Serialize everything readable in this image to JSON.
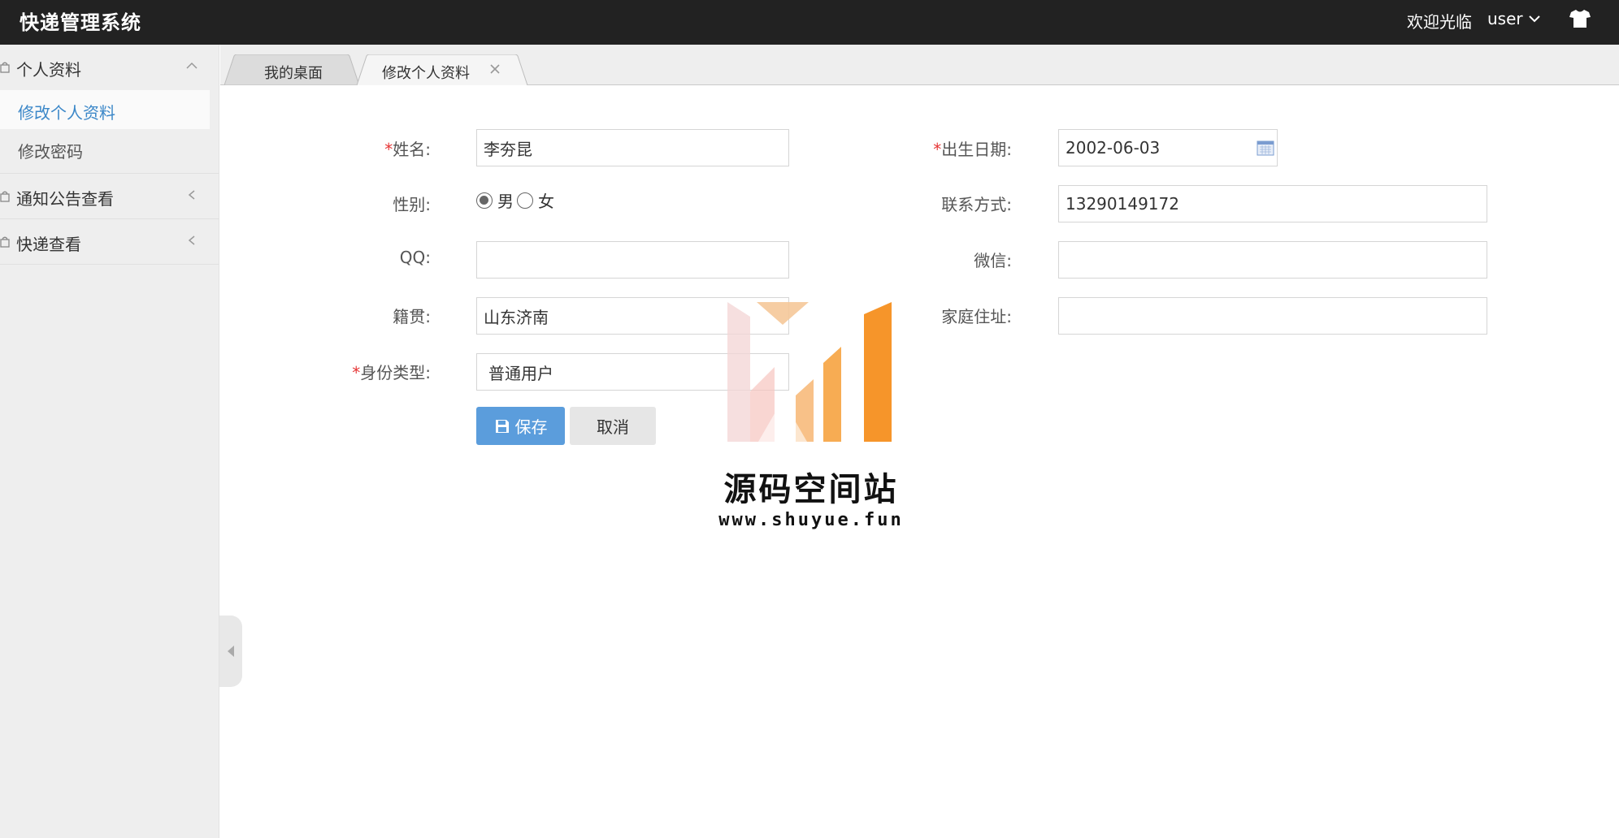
{
  "header": {
    "app_title": "快递管理系统",
    "welcome": "欢迎光临",
    "username": "user"
  },
  "sidebar": {
    "groups": [
      {
        "label": "个人资料",
        "expanded": true,
        "items": [
          {
            "label": "修改个人资料",
            "active": true
          },
          {
            "label": "修改密码",
            "active": false
          }
        ]
      },
      {
        "label": "通知公告查看",
        "expanded": false
      },
      {
        "label": "快递查看",
        "expanded": false
      }
    ]
  },
  "tabs": [
    {
      "label": "我的桌面",
      "active": false
    },
    {
      "label": "修改个人资料",
      "active": true,
      "closable": true
    }
  ],
  "form": {
    "name": {
      "label": "姓名:",
      "required": true,
      "value": "李夯昆"
    },
    "birth_date": {
      "label": "出生日期:",
      "required": true,
      "value": "2002-06-03"
    },
    "gender": {
      "label": "性别:",
      "options": [
        "男",
        "女"
      ],
      "selected": "男"
    },
    "phone": {
      "label": "联系方式:",
      "value": "13290149172"
    },
    "qq": {
      "label": "QQ:",
      "value": ""
    },
    "wechat": {
      "label": "微信:",
      "value": ""
    },
    "hometown": {
      "label": "籍贯:",
      "value": "山东济南"
    },
    "address": {
      "label": "家庭住址:",
      "value": ""
    },
    "identity_type": {
      "label": "身份类型:",
      "required": true,
      "value": "普通用户"
    },
    "save_label": "保存",
    "cancel_label": "取消"
  },
  "watermark": {
    "title": "源码空间站",
    "url": "www.shuyue.fun"
  },
  "colors": {
    "header_bg": "#222222",
    "primary": "#5b9ddc",
    "active_link": "#3b87c8",
    "required": "#e63535"
  }
}
